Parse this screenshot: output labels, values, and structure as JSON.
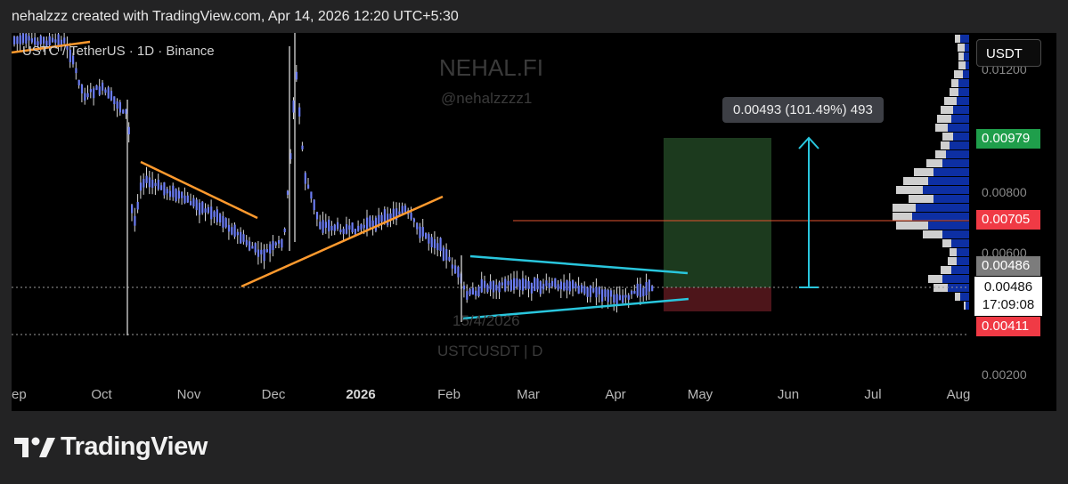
{
  "header": {
    "text": "nehalzzz created with TradingView.com, Apr 14, 2026 12:20 UTC+5:30"
  },
  "chart": {
    "symbol_info": "USTC / TetherUS · 1D · Binance",
    "watermark": {
      "title": "NEHAL.FI",
      "handle": "@nehalzzzz1",
      "date": "15/4/2026",
      "symbol": "USTCUSDT | D"
    },
    "currency_button": "USDT",
    "price_scale": {
      "top_partial": "0.01200",
      "ticks": [
        "0.00800",
        "0.00600",
        "0.00200"
      ]
    },
    "badges": {
      "target": "0.00979",
      "resistance": "0.00705",
      "ask": "0.00486",
      "last_price": "0.00486",
      "countdown": "17:09:08",
      "stop": "0.00411"
    },
    "measure_label": "0.00493 (101.49%) 493",
    "time_axis": [
      "ep",
      "Oct",
      "Nov",
      "Dec",
      "2026",
      "Feb",
      "Mar",
      "Apr",
      "May",
      "Jun",
      "Jul",
      "Aug"
    ],
    "colors": {
      "candle": "#6b7cf2",
      "wick": "#d8d8d8",
      "trendline_orange": "#ff9a2e",
      "triangle_cyan": "#29c6dd",
      "resistance_line": "#e2532f",
      "profit_zone": "#1c3a1e",
      "loss_zone": "#4d151a",
      "badge_green": "#1f9e4b",
      "badge_red": "#f03a45",
      "volume_blue": "#0d2fa3",
      "volume_gray": "#cfcfcf"
    }
  },
  "brand": {
    "name": "TradingView",
    "logo_icon": "tradingview-logo-icon"
  }
}
